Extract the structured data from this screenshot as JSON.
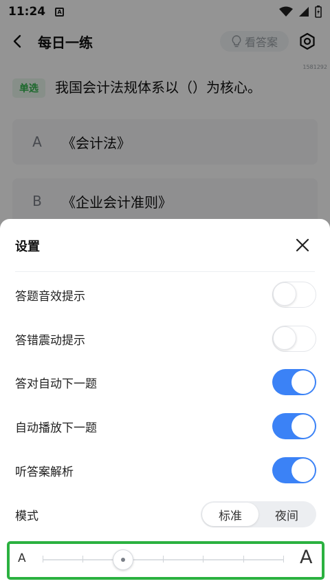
{
  "status_bar": {
    "time": "11:24",
    "notification_label": "A"
  },
  "header": {
    "title": "每日一练",
    "answer_button": "看答案"
  },
  "question": {
    "id": "1581292",
    "type": "单选",
    "text": "我国会计法规体系以（）为核心。",
    "options": [
      {
        "letter": "A",
        "text": "《会计法》"
      },
      {
        "letter": "B",
        "text": "《企业会计准则》"
      }
    ]
  },
  "settings": {
    "title": "设置",
    "toggles": [
      {
        "label": "答题音效提示",
        "on": false
      },
      {
        "label": "答错震动提示",
        "on": false
      },
      {
        "label": "答对自动下一题",
        "on": true
      },
      {
        "label": "自动播放下一题",
        "on": true
      },
      {
        "label": "听答案解析",
        "on": true
      }
    ],
    "mode": {
      "label": "模式",
      "options": [
        "标准",
        "夜间"
      ],
      "selected": "标准"
    },
    "font_size": {
      "small_label": "A",
      "large_label": "A",
      "steps": 7,
      "selected_index": 2
    }
  },
  "colors": {
    "accent": "#3b82f6",
    "highlight_border": "#2bb140",
    "tag_green": "#2fb34a"
  }
}
